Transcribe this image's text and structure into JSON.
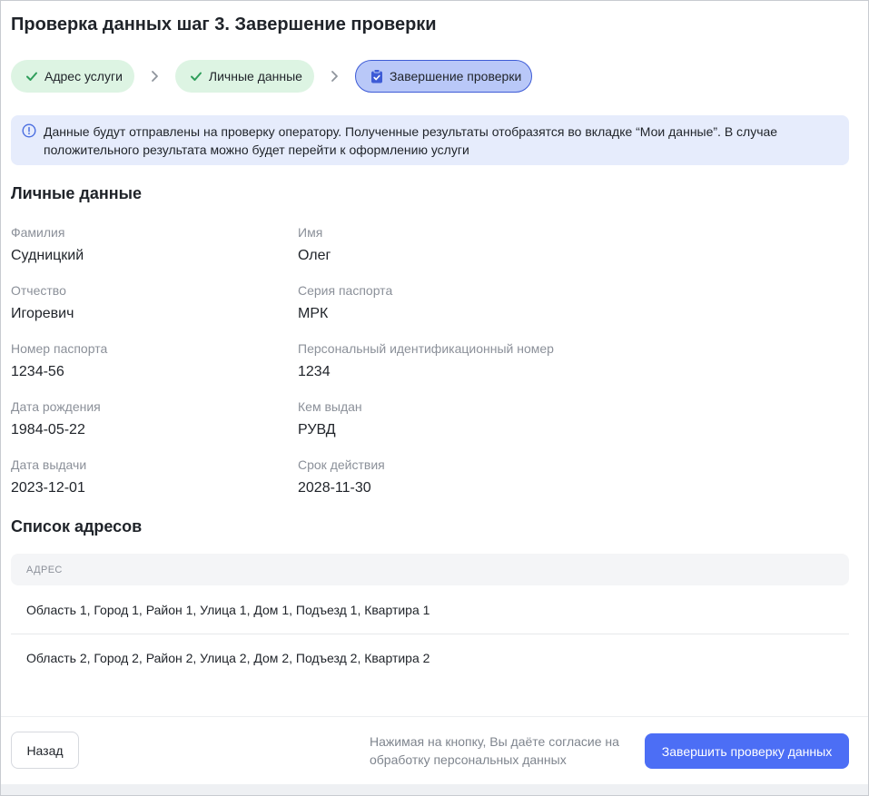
{
  "page": {
    "title": "Проверка данных шаг 3. Завершение проверки"
  },
  "stepper": {
    "separator_icon": "chevron-right-icon",
    "steps": [
      {
        "label": "Адрес услуги",
        "icon": "check-icon"
      },
      {
        "label": "Личные данные",
        "icon": "check-icon"
      },
      {
        "label": "Завершение проверки",
        "icon": "clipboard-check-icon"
      }
    ]
  },
  "notice": {
    "icon": "info-icon",
    "text": "Данные будут отправлены на проверку оператору. Полученные результаты отобразятся во вкладке “Мои данные”. В случае положительного результата можно будет перейти к оформлению услуги"
  },
  "personal": {
    "heading": "Личные данные",
    "fields": [
      {
        "label": "Фамилия",
        "value": "Судницкий"
      },
      {
        "label": "Имя",
        "value": "Олег"
      },
      {
        "label": "Отчество",
        "value": "Игоревич"
      },
      {
        "label": "Серия паспорта",
        "value": "МРК"
      },
      {
        "label": "Номер паспорта",
        "value": "1234-56"
      },
      {
        "label": "Персональный идентификационный номер",
        "value": "1234"
      },
      {
        "label": "Дата рождения",
        "value": "1984-05-22"
      },
      {
        "label": "Кем выдан",
        "value": "РУВД"
      },
      {
        "label": "Дата выдачи",
        "value": "2023-12-01"
      },
      {
        "label": "Срок действия",
        "value": "2028-11-30"
      }
    ]
  },
  "addresses": {
    "heading": "Список адресов",
    "column_header": "АДРЕС",
    "rows": [
      "Область 1, Город 1, Район 1, Улица 1, Дом 1, Подъезд 1, Квартира 1",
      "Область 2, Город 2, Район 2, Улица 2, Дом 2, Подъезд 2, Квартира 2"
    ]
  },
  "footer": {
    "back_label": "Назад",
    "consent_lines": [
      "Нажимая на кнопку, Вы даёте согласие на",
      "обработку персональных данных"
    ],
    "submit_label": "Завершить проверку данных"
  },
  "colors": {
    "text": "#1f2329",
    "muted": "#8b9099",
    "accent": "#4c6ef5",
    "success": "#2f9e5b",
    "success_bg": "#ddf4e3",
    "current_bg": "#b9c8f8",
    "current_border": "#3d5bd6",
    "notice_bg": "#e6ecfc"
  }
}
